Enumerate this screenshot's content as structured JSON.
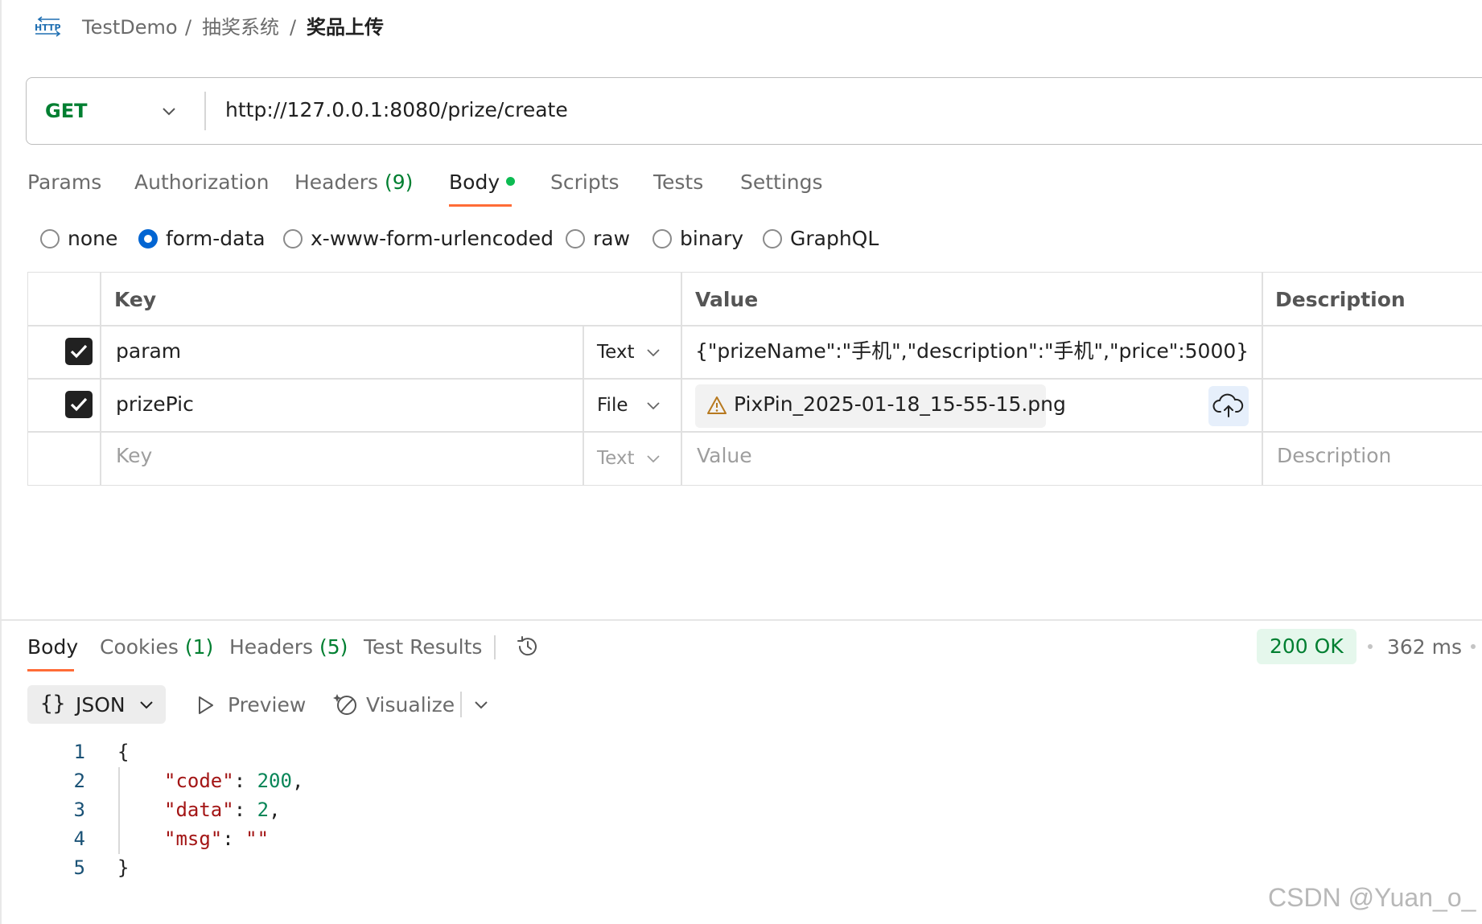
{
  "breadcrumb": {
    "icon_label": "HTTP",
    "workspace": "TestDemo",
    "sep1": "/",
    "folder": "抽奖系统",
    "sep2": "/",
    "request": "奖品上传"
  },
  "request": {
    "method": "GET",
    "url": "http://127.0.0.1:8080/prize/create"
  },
  "request_tabs": [
    {
      "label": "Params"
    },
    {
      "label": "Authorization"
    },
    {
      "label": "Headers",
      "count": "(9)"
    },
    {
      "label": "Body",
      "active": true
    },
    {
      "label": "Scripts"
    },
    {
      "label": "Tests"
    },
    {
      "label": "Settings"
    }
  ],
  "body_modes": [
    {
      "label": "none"
    },
    {
      "label": "form-data",
      "selected": true
    },
    {
      "label": "x-www-form-urlencoded"
    },
    {
      "label": "raw"
    },
    {
      "label": "binary"
    },
    {
      "label": "GraphQL"
    }
  ],
  "form_table": {
    "headers": {
      "key": "Key",
      "value": "Value",
      "description": "Description"
    },
    "rows": [
      {
        "checked": true,
        "key": "param",
        "type": "Text",
        "value": "{\"prizeName\":\"手机\",\"description\":\"手机\",\"price\":5000}"
      },
      {
        "checked": true,
        "key": "prizePic",
        "type": "File",
        "value": "PixPin_2025-01-18_15-55-15.png"
      }
    ],
    "placeholder_row": {
      "key": "Key",
      "type": "Text",
      "value": "Value",
      "description": "Description"
    }
  },
  "response": {
    "tabs": [
      {
        "label": "Body",
        "active": true
      },
      {
        "label": "Cookies",
        "count": "(1)"
      },
      {
        "label": "Headers",
        "count": "(5)"
      },
      {
        "label": "Test Results"
      }
    ],
    "status": "200 OK",
    "time": "362 ms",
    "format": "JSON",
    "format_icon": "{}",
    "preview_label": "Preview",
    "visualize_label": "Visualize",
    "code_lines": [
      {
        "n": "1",
        "text": "{"
      },
      {
        "n": "2",
        "key": "\"code\"",
        "val": "200",
        "tail": ","
      },
      {
        "n": "3",
        "key": "\"data\"",
        "val": "2",
        "tail": ","
      },
      {
        "n": "4",
        "key": "\"msg\"",
        "strval": "\"\"",
        "tail": ""
      },
      {
        "n": "5",
        "text": "}"
      }
    ]
  },
  "watermark": "CSDN @Yuan_o_",
  "colors": {
    "accent": "#ff6c37",
    "method_green": "#007f31",
    "radio_blue": "#0265d2",
    "status_green": "#007f31",
    "dot_green": "#0cbb52"
  }
}
